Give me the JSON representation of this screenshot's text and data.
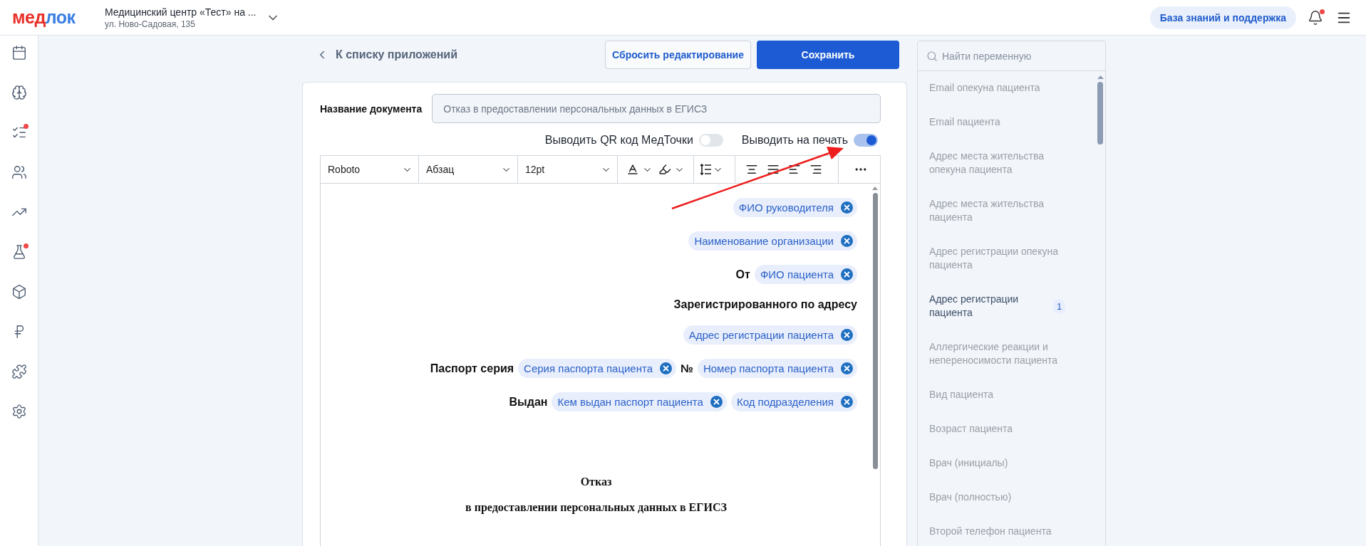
{
  "header": {
    "logo_parts": [
      {
        "text": "мед",
        "color": "#e8302a"
      },
      {
        "text": "лок",
        "color": "#3a7ee4"
      }
    ],
    "clinic": {
      "name": "Медицинский центр «Тест» на ...",
      "address": "ул. Ново-Садовая, 135"
    },
    "help_button": "База знаний и поддержка",
    "notifications": {
      "unread": true
    }
  },
  "sidebar": {
    "items": [
      {
        "kind": "calendar",
        "alert": false
      },
      {
        "kind": "ornament",
        "alert": false
      },
      {
        "kind": "tasks",
        "alert": true
      },
      {
        "kind": "people",
        "alert": false
      },
      {
        "kind": "chart",
        "alert": false
      },
      {
        "kind": "lab",
        "alert": true
      },
      {
        "kind": "box",
        "alert": false
      },
      {
        "kind": "ruble",
        "alert": false
      },
      {
        "kind": "puzzle",
        "alert": false
      },
      {
        "kind": "settings",
        "alert": false
      }
    ]
  },
  "back_link": "К списку приложений",
  "buttons": {
    "reset": "Сбросить редактирование",
    "save": "Сохранить"
  },
  "document_name": {
    "label": "Название документа",
    "value": "Отказ в предоставлении персональных данных в ЕГИСЗ"
  },
  "toggles": [
    {
      "label": "Выводить QR код МедТочки",
      "on": false
    },
    {
      "label": "Выводить на печать",
      "on": true
    }
  ],
  "toolbar": {
    "font": "Roboto",
    "block": "Абзац",
    "size": "12pt"
  },
  "editor": {
    "lines": [
      {
        "kind": "fields",
        "items": [
          {
            "kind": "chip",
            "text": "ФИО руководителя"
          }
        ]
      },
      {
        "kind": "fields",
        "items": [
          {
            "kind": "chip",
            "text": "Наименование организации"
          }
        ]
      },
      {
        "kind": "fields",
        "items": [
          {
            "kind": "label",
            "text": "От"
          },
          {
            "kind": "chip",
            "text": "ФИО пациента"
          }
        ]
      },
      {
        "kind": "heading",
        "text": "Зарегистрированного по адресу"
      },
      {
        "kind": "fields",
        "items": [
          {
            "kind": "chip",
            "text": "Адрес регистрации пациента"
          }
        ]
      },
      {
        "kind": "fields",
        "items": [
          {
            "kind": "label",
            "text": "Паспорт серия"
          },
          {
            "kind": "chip",
            "text": "Серия паспорта пациента"
          },
          {
            "kind": "label",
            "text": "№"
          },
          {
            "kind": "chip",
            "text": "Номер паспорта пациента"
          }
        ]
      },
      {
        "kind": "fields",
        "items": [
          {
            "kind": "label",
            "text": "Выдан"
          },
          {
            "kind": "chip",
            "text": "Кем выдан паспорт пациента"
          },
          {
            "kind": "chip",
            "text": "Код подразделения"
          }
        ]
      },
      {
        "kind": "title",
        "text": "Отказ"
      },
      {
        "kind": "title",
        "text": "в предоставлении персональных данных в ЕГИСЗ"
      }
    ]
  },
  "variables": {
    "placeholder": "Найти переменную",
    "items": [
      {
        "label": "Email опекуна пациента",
        "used": false
      },
      {
        "label": "Email пациента",
        "used": false
      },
      {
        "label": "Адрес места жительства опекуна пациента",
        "used": false
      },
      {
        "label": "Адрес места жительства пациента",
        "used": false
      },
      {
        "label": "Адрес регистрации опекуна пациента",
        "used": false
      },
      {
        "label": "Адрес регистрации пациента",
        "used": true,
        "count": "1"
      },
      {
        "label": "Аллергические реакции и непереносимости пациента",
        "used": false
      },
      {
        "label": "Вид пациента",
        "used": false
      },
      {
        "label": "Возраст пациента",
        "used": false
      },
      {
        "label": "Врач (инициалы)",
        "used": false
      },
      {
        "label": "Врач (полностью)",
        "used": false
      },
      {
        "label": "Второй телефон пациента",
        "used": false
      }
    ]
  }
}
